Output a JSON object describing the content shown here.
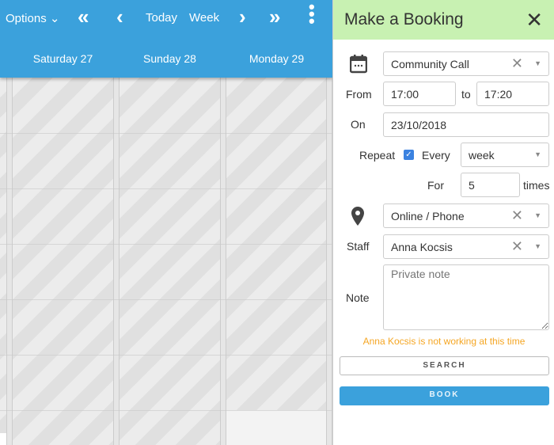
{
  "calendar": {
    "options_label": "Options",
    "today_label": "Today",
    "week_label": "Week",
    "days": [
      "Saturday 27",
      "Sunday 28",
      "Monday 29"
    ]
  },
  "booking": {
    "title": "Make a Booking",
    "event_type": "Community Call",
    "from_label": "From",
    "from_value": "17:00",
    "to_label": "to",
    "to_value": "17:20",
    "on_label": "On",
    "on_value": "23/10/2018",
    "repeat_label": "Repeat",
    "repeat_checked": true,
    "every_label": "Every",
    "every_value": "week",
    "for_label": "For",
    "for_value": "5",
    "times_label": "times",
    "location": "Online / Phone",
    "staff_label": "Staff",
    "staff_value": "Anna Kocsis",
    "note_label": "Note",
    "note_placeholder": "Private note",
    "warning": "Anna Kocsis is not working at this time",
    "search_label": "SEARCH",
    "book_label": "BOOK"
  },
  "colors": {
    "header": "#3ba1dc",
    "panel_header": "#c8f1b2",
    "warning": "#f5a623"
  }
}
